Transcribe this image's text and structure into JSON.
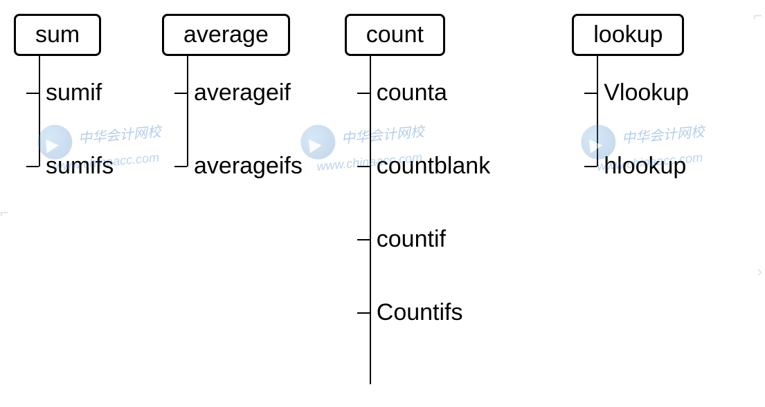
{
  "trees": [
    {
      "key": "sum",
      "root": "sum",
      "children": [
        "sumif",
        "sumifs"
      ]
    },
    {
      "key": "average",
      "root": "average",
      "children": [
        "averageif",
        "averageifs"
      ]
    },
    {
      "key": "count",
      "root": "count",
      "children": [
        "counta",
        "countblank",
        "countif",
        "Countifs"
      ]
    },
    {
      "key": "lookup",
      "root": "lookup",
      "children": [
        "Vlookup",
        "hlookup"
      ]
    }
  ],
  "watermark": {
    "brand": "中华会计网校",
    "url": "www.chinaacc.com"
  }
}
